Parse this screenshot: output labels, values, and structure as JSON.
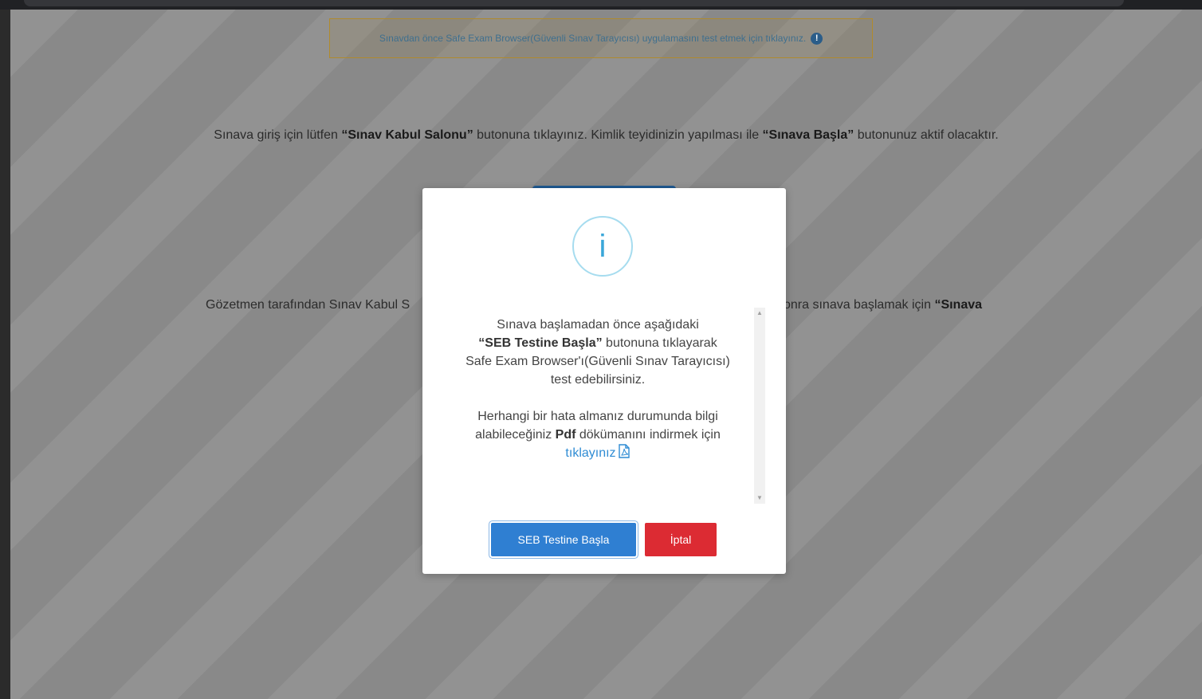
{
  "alert": {
    "text": "Sınavdan önce Safe Exam Browser(Güvenli Sınav Tarayıcısı) uygulamasını test etmek için tıklayınız.",
    "icon": "exclamation-circle-icon"
  },
  "background": {
    "para1": {
      "part1": "Sınava giriş için lütfen ",
      "bold1": "“Sınav Kabul Salonu”",
      "part2": " butonuna tıklayınız. Kimlik teyidinizin yapılması ile ",
      "bold2": "“Sınava Başla”",
      "part3": " butonunuz aktif olacaktır."
    },
    "para2_left": "Gözetmen tarafından Sınav Kabul S",
    "para2_right": "onra sınava başlamak için ",
    "para2_right_bold": "“Sınava"
  },
  "modal": {
    "icon": "info-icon",
    "line1": "Sınava başlamadan önce aşağıdaki",
    "line2_bold": "“SEB Testine Başla”",
    "line2_rest": " butonuna tıklayarak",
    "line3": "Safe Exam Browser'ı(Güvenli Sınav Tarayıcısı)",
    "line4": "test edebilirsiniz.",
    "line5": "Herhangi bir hata almanız durumunda bilgi",
    "line6_start": "alabileceğiniz ",
    "line6_bold": "Pdf",
    "line6_rest": " dökümanını indirmek için",
    "link": "tıklayınız",
    "primary_button": "SEB Testine Başla",
    "cancel_button": "İptal"
  },
  "colors": {
    "primary": "#2f7fd2",
    "danger": "#dc2b33",
    "info": "#3aa7d9",
    "link": "#2f8cd4"
  }
}
